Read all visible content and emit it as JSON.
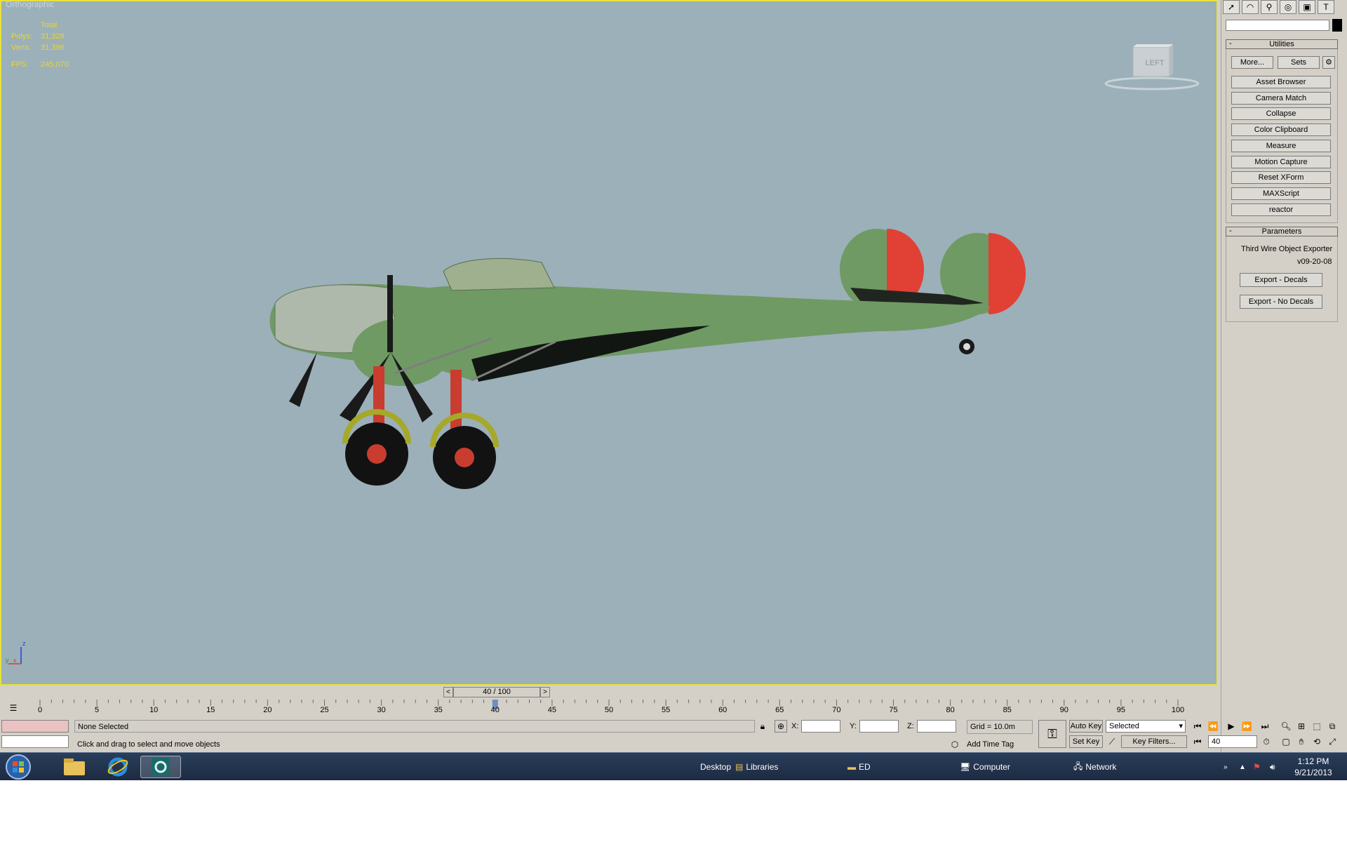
{
  "viewport": {
    "label": "Orthographic",
    "stats": {
      "header": "Total",
      "polys_label": "Polys:",
      "polys_value": "31,328",
      "verts_label": "Verts:",
      "verts_value": "31,396",
      "fps_label": "FPS:",
      "fps_value": "245.070"
    },
    "viewcube_label": "LEFT",
    "axis": {
      "z": "z",
      "y": "y",
      "x": "x"
    },
    "colors": {
      "background": "#9bb0b9",
      "border": "#e8e23a",
      "plane_body": "#6f9a64",
      "roundel_red": "#e14035"
    }
  },
  "command_panel": {
    "tabs": [
      "select-icon",
      "modify-icon",
      "hierarchy-icon",
      "motion-icon",
      "display-icon",
      "utilities-icon"
    ],
    "utilities_rollout": {
      "title": "Utilities",
      "collapse": "-",
      "more_button": "More...",
      "sets_button": "Sets",
      "items": [
        "Asset Browser",
        "Camera Match",
        "Collapse",
        "Color Clipboard",
        "Measure",
        "Motion Capture",
        "Reset XForm",
        "MAXScript",
        "reactor"
      ]
    },
    "parameters_rollout": {
      "title": "Parameters",
      "collapse": "-",
      "exporter_name": "Third Wire Object Exporter",
      "exporter_version": "v09-20-08",
      "export_decals": "Export - Decals",
      "export_no_decals": "Export - No Decals"
    }
  },
  "timeline": {
    "slider_label": "40 / 100",
    "prev": "<",
    "next": ">",
    "current_frame": 40,
    "ticks": [
      "0",
      "5",
      "10",
      "15",
      "20",
      "25",
      "30",
      "35",
      "40",
      "45",
      "50",
      "55",
      "60",
      "65",
      "70",
      "75",
      "80",
      "85",
      "90",
      "95",
      "100"
    ]
  },
  "status": {
    "selection": "None Selected",
    "prompt": "Click and drag to select and move objects",
    "x_label": "X:",
    "y_label": "Y:",
    "z_label": "Z:",
    "grid": "Grid = 10.0m",
    "add_time_tag": "Add Time Tag",
    "auto_key": "Auto Key",
    "set_key": "Set Key",
    "selected_dropdown": "Selected",
    "key_filters": "Key Filters...",
    "frame_field": "40"
  },
  "taskbar": {
    "desktop": "Desktop",
    "libraries": "Libraries",
    "ed": "ED",
    "computer": "Computer",
    "network": "Network",
    "time": "1:12 PM",
    "date": "9/21/2013"
  }
}
